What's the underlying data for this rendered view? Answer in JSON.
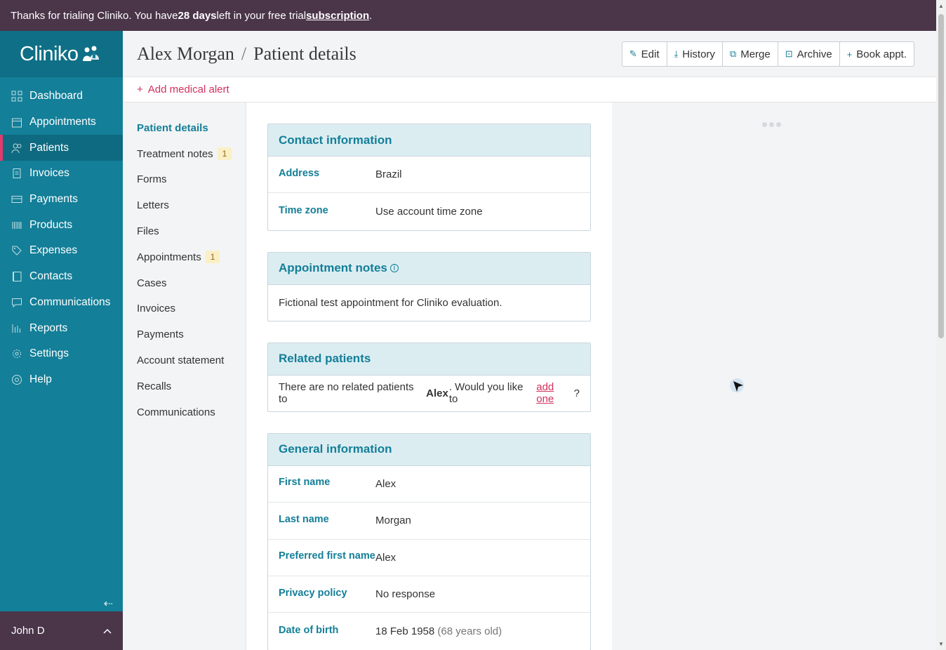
{
  "trial": {
    "prefix": "Thanks for trialing Cliniko. You have ",
    "days": "28 days",
    "middle": " left in your free trial ",
    "link": "subscription",
    "suffix": "."
  },
  "app": {
    "logo": "Cliniko"
  },
  "nav": [
    {
      "label": "Dashboard",
      "icon": "dashboard-icon"
    },
    {
      "label": "Appointments",
      "icon": "calendar-icon"
    },
    {
      "label": "Patients",
      "icon": "patients-icon",
      "active": true
    },
    {
      "label": "Invoices",
      "icon": "invoice-icon"
    },
    {
      "label": "Payments",
      "icon": "card-icon"
    },
    {
      "label": "Products",
      "icon": "barcode-icon"
    },
    {
      "label": "Expenses",
      "icon": "tag-icon"
    },
    {
      "label": "Contacts",
      "icon": "contacts-icon"
    },
    {
      "label": "Communications",
      "icon": "chat-icon"
    },
    {
      "label": "Reports",
      "icon": "chart-icon"
    },
    {
      "label": "Settings",
      "icon": "gear-icon"
    },
    {
      "label": "Help",
      "icon": "help-icon"
    }
  ],
  "user": {
    "name": "John D"
  },
  "header": {
    "patient": "Alex Morgan",
    "separator": "/",
    "page": "Patient details"
  },
  "toolbar": {
    "edit": "Edit",
    "history": "History",
    "merge": "Merge",
    "archive": "Archive",
    "book": "Book appt."
  },
  "alert": {
    "label": "Add medical alert"
  },
  "subnav": [
    {
      "label": "Patient details",
      "active": true
    },
    {
      "label": "Treatment notes",
      "badge": "1"
    },
    {
      "label": "Forms"
    },
    {
      "label": "Letters"
    },
    {
      "label": "Files"
    },
    {
      "label": "Appointments",
      "badge": "1"
    },
    {
      "label": "Cases"
    },
    {
      "label": "Invoices"
    },
    {
      "label": "Payments"
    },
    {
      "label": "Account statement"
    },
    {
      "label": "Recalls"
    },
    {
      "label": "Communications"
    }
  ],
  "contact": {
    "title": "Contact information",
    "address_label": "Address",
    "address": "Brazil",
    "tz_label": "Time zone",
    "tz": "Use account time zone"
  },
  "appt_notes": {
    "title": "Appointment notes",
    "text": "Fictional test appointment for Cliniko evaluation."
  },
  "related": {
    "title": "Related patients",
    "prefix": "There are no related patients to ",
    "name": "Alex",
    "middle": ". Would you like to ",
    "link": "add one",
    "suffix": "?"
  },
  "general": {
    "title": "General information",
    "rows": [
      {
        "label": "First name",
        "value": "Alex"
      },
      {
        "label": "Last name",
        "value": "Morgan"
      },
      {
        "label": "Preferred first name",
        "value": "Alex"
      },
      {
        "label": "Privacy policy",
        "value": "No response"
      },
      {
        "label": "Date of birth",
        "value": "18 Feb 1958",
        "extra": "(68 years old)"
      }
    ]
  }
}
